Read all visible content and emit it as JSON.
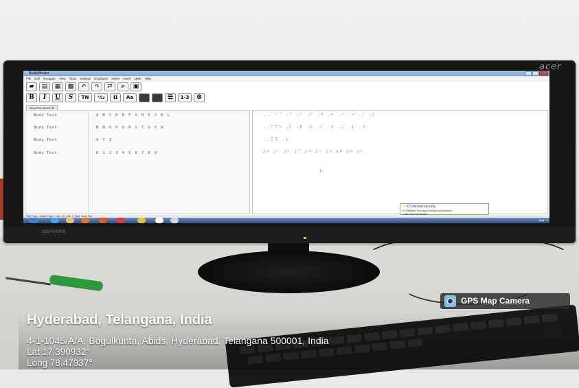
{
  "scene": {
    "monitor_brand": "acer",
    "monitor_model": "185HV50FB"
  },
  "app": {
    "title": "BrailleBlaster",
    "menu": [
      "File",
      "Edit",
      "Navigate",
      "View",
      "Tools",
      "Settings",
      "Emphasis",
      "Styles",
      "Insert",
      "Math",
      "Help"
    ],
    "toolbar_row1_icons": [
      "open-folder-icon",
      "open-file-icon",
      "print-icon",
      "emboss-icon",
      "undo-icon",
      "redo-icon",
      "translate-icon",
      "search-icon",
      "image-icon"
    ],
    "toolbar_row2": [
      "B",
      "I",
      "U",
      "S",
      "TN",
      "⁺⁄₁₂",
      "π",
      "Aa",
      "",
      "",
      "",
      "1-3",
      ""
    ],
    "document_tab": "New Document ☒",
    "rows": [
      {
        "style": "Body Text",
        "text": "A B C D E F G H I J K L",
        "braille": "⠠⠠⠁⠃⠉ ⠠⠙ ⠠⠑ ⠠⠋ ⠠⠛ ⠠⠓ ⠠⠊ ⠠⠚ ⠠⠅ ⠠⠇"
      },
      {
        "style": "Body Text",
        "text": "M N O P Q R S T U V W",
        "braille": "⠠⠠⠍⠝⠕ ⠠⠏ ⠠⠟ ⠠⠗ ⠠⠎ ⠠⠞ ⠠⠥ ⠠⠧ ⠠⠺"
      },
      {
        "style": "Body Text",
        "text": "X Y Z",
        "braille": "⠠⠠⠭⠽ ⠠⠵"
      },
      {
        "style": "Body Text",
        "text": "0 1 2 3 4 5 6 7 8 9",
        "braille": "⠼⠚ ⠼⠁ ⠼⠃ ⠼⠉ ⠼⠙ ⠼⠑ ⠼⠋ ⠼⠛ ⠼⠓ ⠼⠊"
      }
    ],
    "status_bar": "Print Page: | Braille Page: | Line: 10 | Cell: 1 | Style: Body Text",
    "notification": {
      "title": "K7UltimateSecurity",
      "body": "K7Ultimate Security License has expired.",
      "link": "Click here to resolve."
    }
  },
  "gps_overlay": {
    "badge": "GPS Map Camera",
    "city": "Hyderabad, Telangana, India",
    "address": "4-1-1045/A/A, Bogulkunta, Abids, Hyderabad, Telangana 500001, India",
    "lat": "Lat 17.390932°",
    "long": "Long 78.47937°"
  }
}
